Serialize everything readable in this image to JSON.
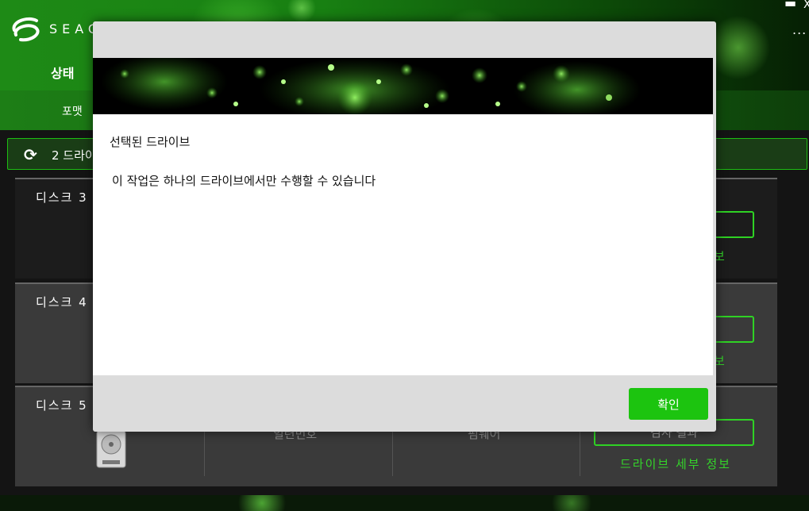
{
  "app": {
    "brand_text": "SEAG",
    "window_minimize_glyph": "▬",
    "window_close_glyph": "X",
    "more_glyph": "...",
    "nav_status_label": "상태",
    "subnav_format_label": "포맷"
  },
  "toolbar": {
    "refresh_icon": "refresh-icon",
    "drive_count_text": "2 드라이"
  },
  "disks": [
    {
      "label": "디스크 3",
      "link": "보"
    },
    {
      "label": "디스크 4",
      "link": "보"
    },
    {
      "label": "디스크 5",
      "col1": "일련번호",
      "col2": "펌웨어",
      "button": "검사 결과",
      "link": "드라이브 세부 정보"
    }
  ],
  "dialog": {
    "title": "선택된 드라이브",
    "message": "이 작업은 하나의 드라이브에서만 수행할 수 있습니다",
    "ok_label": "확인"
  },
  "colors": {
    "accent_green": "#1cc40f",
    "link_green": "#34d42a"
  }
}
